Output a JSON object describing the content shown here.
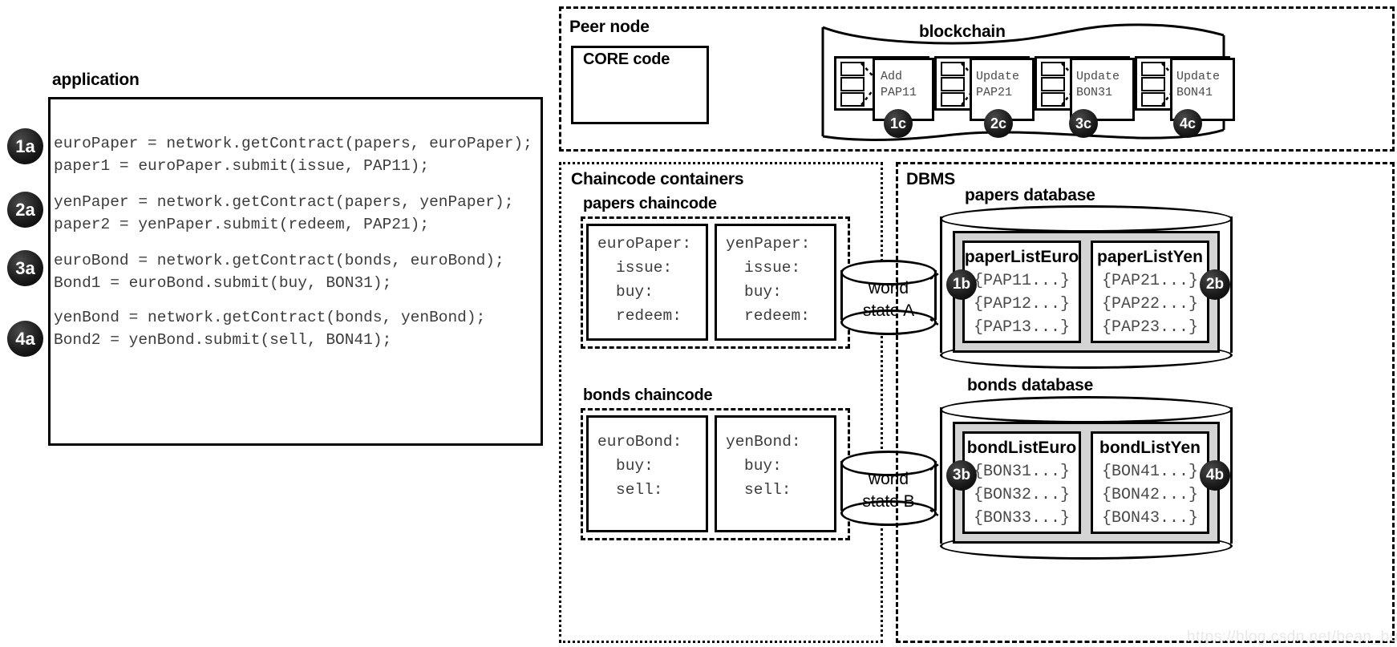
{
  "application": {
    "title": "application",
    "code_blocks": [
      {
        "badge": "1a",
        "lines": [
          "euroPaper = network.getContract(papers, euroPaper);",
          "paper1 = euroPaper.submit(issue, PAP11);"
        ]
      },
      {
        "badge": "2a",
        "lines": [
          "yenPaper = network.getContract(papers, yenPaper);",
          "paper2 = yenPaper.submit(redeem, PAP21);"
        ]
      },
      {
        "badge": "3a",
        "lines": [
          "euroBond = network.getContract(bonds, euroBond);",
          "Bond1 = euroBond.submit(buy, BON31);"
        ]
      },
      {
        "badge": "4a",
        "lines": [
          "yenBond = network.getContract(bonds, yenBond);",
          "Bond2 = yenBond.submit(sell, BON41);"
        ]
      }
    ]
  },
  "peer_node": {
    "title": "Peer node",
    "core_code_label": "CORE code"
  },
  "blockchain": {
    "title": "blockchain",
    "blocks": [
      {
        "line1": "Add",
        "line2": "PAP11",
        "badge": "1c"
      },
      {
        "line1": "Update",
        "line2": "PAP21",
        "badge": "2c"
      },
      {
        "line1": "Update",
        "line2": "BON31",
        "badge": "3c"
      },
      {
        "line1": "Update",
        "line2": "BON41",
        "badge": "4c"
      }
    ]
  },
  "chaincode_containers": {
    "title": "Chaincode containers",
    "groups": [
      {
        "title": "papers chaincode",
        "contracts": [
          {
            "name": "euroPaper:",
            "methods": [
              "issue:",
              "buy:",
              "redeem:"
            ]
          },
          {
            "name": "yenPaper:",
            "methods": [
              "issue:",
              "buy:",
              "redeem:"
            ]
          }
        ]
      },
      {
        "title": "bonds chaincode",
        "contracts": [
          {
            "name": "euroBond:",
            "methods": [
              "buy:",
              "sell:"
            ]
          },
          {
            "name": "yenBond:",
            "methods": [
              "buy:",
              "sell:"
            ]
          }
        ]
      }
    ]
  },
  "world_states": [
    {
      "line1": "world",
      "line2": "state A"
    },
    {
      "line1": "world",
      "line2": "state B"
    }
  ],
  "dbms": {
    "title": "DBMS",
    "databases": [
      {
        "title": "papers database",
        "lists": [
          {
            "name": "paperListEuro",
            "badge": "1b",
            "badge_side": "left",
            "rows": [
              "{PAP11...}",
              "{PAP12...}",
              "{PAP13...}"
            ]
          },
          {
            "name": "paperListYen",
            "badge": "2b",
            "badge_side": "right",
            "rows": [
              "{PAP21...}",
              "{PAP22...}",
              "{PAP23...}"
            ]
          }
        ]
      },
      {
        "title": "bonds database",
        "lists": [
          {
            "name": "bondListEuro",
            "badge": "3b",
            "badge_side": "left",
            "rows": [
              "{BON31...}",
              "{BON32...}",
              "{BON33...}"
            ]
          },
          {
            "name": "bondListYen",
            "badge": "4b",
            "badge_side": "right",
            "rows": [
              "{BON41...}",
              "{BON42...}",
              "{BON43...}"
            ]
          }
        ]
      }
    ]
  },
  "watermark": {
    "text": "https://blog.csdn.net/bean_business"
  }
}
